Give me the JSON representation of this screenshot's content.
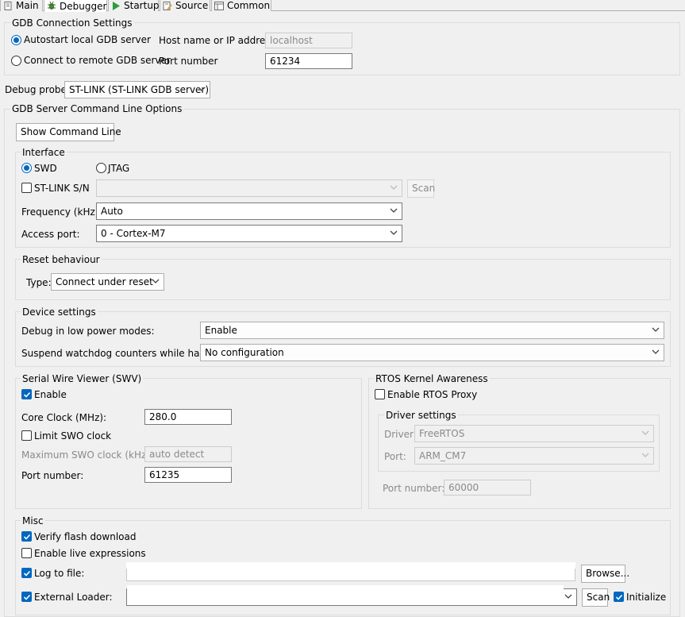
{
  "tabs": [
    {
      "label": "Main",
      "icon": "document-icon"
    },
    {
      "label": "Debugger",
      "icon": "bug-icon",
      "active": true
    },
    {
      "label": "Startup",
      "icon": "play-icon"
    },
    {
      "label": "Source",
      "icon": "source-icon"
    },
    {
      "label": "Common",
      "icon": "common-icon"
    }
  ],
  "gdb_connection": {
    "title": "GDB Connection Settings",
    "autostart_label": "Autostart local GDB server",
    "remote_label": "Connect to remote GDB server",
    "host_label": "Host name or IP address",
    "host_value": "localhost",
    "port_label": "Port number",
    "port_value": "61234"
  },
  "debug_probe": {
    "label": "Debug probe",
    "value": "ST-LINK (ST-LINK GDB server)"
  },
  "gdb_server_options": {
    "title": "GDB Server Command Line Options",
    "show_cmd_label": "Show Command Line"
  },
  "interface": {
    "title": "Interface",
    "swd_label": "SWD",
    "jtag_label": "JTAG",
    "stlink_sn_label": "ST-LINK S/N",
    "scan_label": "Scan",
    "frequency_label": "Frequency (kHz):",
    "frequency_value": "Auto",
    "access_port_label": "Access port:",
    "access_port_value": "0 - Cortex-M7"
  },
  "reset": {
    "title": "Reset behaviour",
    "type_label": "Type:",
    "type_value": "Connect under reset"
  },
  "device": {
    "title": "Device settings",
    "low_power_label": "Debug in low power modes:",
    "low_power_value": "Enable",
    "watchdog_label": "Suspend watchdog counters while halted:",
    "watchdog_value": "No configuration"
  },
  "swv": {
    "title": "Serial Wire Viewer (SWV)",
    "enable_label": "Enable",
    "core_clock_label": "Core Clock (MHz):",
    "core_clock_value": "280.0",
    "limit_swo_label": "Limit SWO clock",
    "max_swo_label": "Maximum SWO clock (kHz):",
    "max_swo_value": "auto detect",
    "port_label": "Port number:",
    "port_value": "61235"
  },
  "rtos": {
    "title": "RTOS Kernel Awareness",
    "enable_proxy_label": "Enable RTOS Proxy",
    "driver_settings_title": "Driver settings",
    "driver_label": "Driver:",
    "driver_value": "FreeRTOS",
    "port_label": "Port:",
    "port_value": "ARM_CM7",
    "port_number_label": "Port number:",
    "port_number_value": "60000"
  },
  "misc": {
    "title": "Misc",
    "verify_flash_label": "Verify flash download",
    "live_expr_label": "Enable live expressions",
    "log_label": "Log to file:",
    "browse_label": "Browse...",
    "ext_loader_label": "External Loader:",
    "scan_label": "Scan",
    "initialize_label": "Initialize"
  },
  "colors": {
    "accent": "#0067c0",
    "window_bg": "#f0f0f0"
  }
}
